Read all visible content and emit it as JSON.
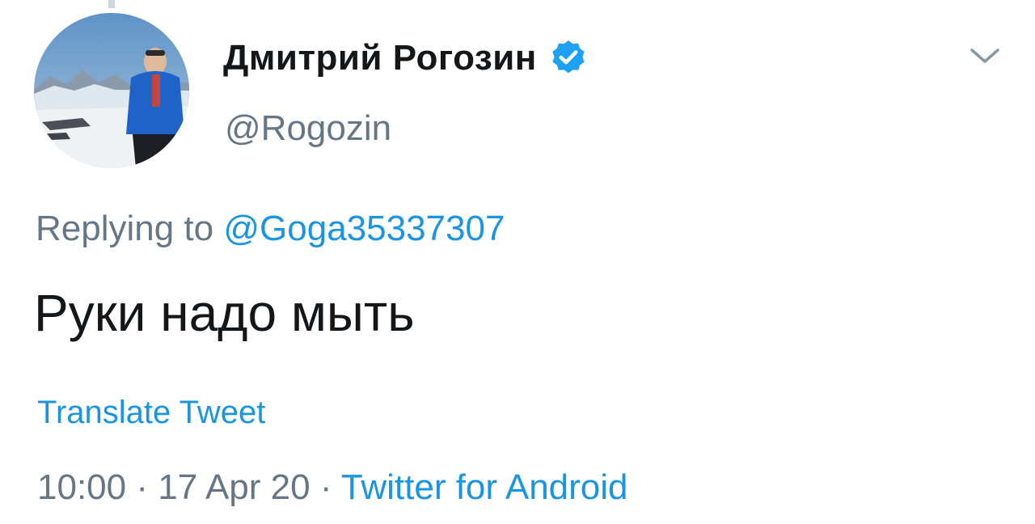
{
  "tweet": {
    "author": {
      "display_name": "Дмитрий Рогозин",
      "handle": "@Rogozin",
      "verified": true
    },
    "reply": {
      "prefix": "Replying to ",
      "mention": "@Goga35337307"
    },
    "text": "Руки надо мыть",
    "translate_label": "Translate Tweet",
    "meta": {
      "time": "10:00",
      "separator": " · ",
      "date": "17 Apr 20",
      "source": "Twitter for Android"
    }
  },
  "icons": {
    "verified": "verified-badge-icon",
    "menu": "chevron-down-icon"
  },
  "colors": {
    "link": "#1b95e0",
    "muted": "#657786",
    "text": "#14171a",
    "verified": "#1da1f2"
  }
}
